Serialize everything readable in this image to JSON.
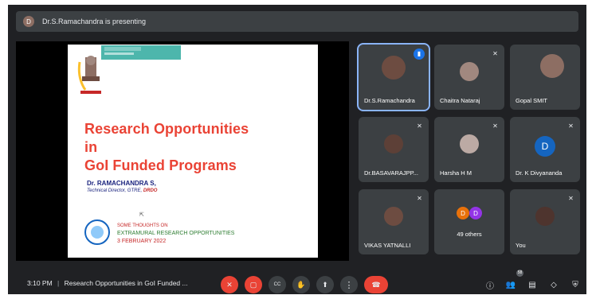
{
  "banner": {
    "avatar_letter": "D",
    "text": "Dr.S.Ramachandra is presenting"
  },
  "slide": {
    "title_lines": [
      "Research Opportunities",
      "in",
      "GoI Funded Programs"
    ],
    "author": "Dr. RAMACHANDRA S,",
    "role_prefix": "Technical Director, GTRE, ",
    "role_org": "DRDO",
    "note_1": "SOME THOUGHTS ON",
    "note_2": "EXTRAMURAL RESEARCH OPPORTUNITIES",
    "note_3": "3 FEBRUARY 2022"
  },
  "participants": [
    {
      "name": "Dr.S.Ramachandra"
    },
    {
      "name": "Chaitra Nataraj"
    },
    {
      "name": "Gopal SMIT"
    },
    {
      "name": "Dr.BASAVARAJPP..."
    },
    {
      "name": "Harsha H M"
    },
    {
      "name": "Dr. K Divyananda",
      "letter": "D"
    },
    {
      "name": "VIKAS YATNALLI"
    },
    {
      "name": "49 others",
      "letters": [
        "D",
        "D"
      ]
    },
    {
      "name": "You"
    }
  ],
  "bottom": {
    "time": "3:10 PM",
    "separator": "|",
    "meeting_title": "Research Opportunities in GoI Funded ...",
    "participants_badge": "58"
  },
  "colors": {
    "accent": "#1a73e8",
    "danger": "#ea4335",
    "surface": "#3c4043",
    "background": "#202124"
  },
  "icons": [
    "mic-off-icon",
    "camera-off-icon",
    "captions-icon",
    "raise-hand-icon",
    "present-icon",
    "more-icon",
    "end-call-icon",
    "info-icon",
    "people-icon",
    "chat-icon",
    "activities-icon",
    "host-controls-icon"
  ]
}
